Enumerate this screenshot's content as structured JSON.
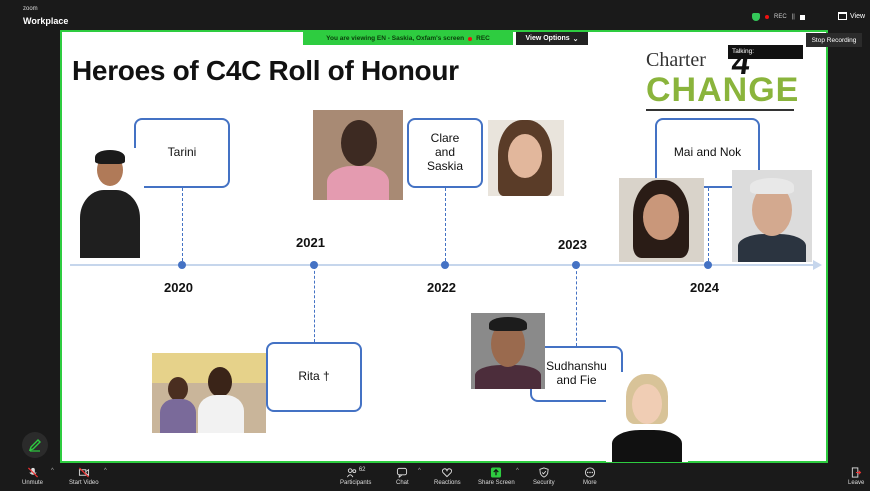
{
  "app": {
    "brand_small": "zoom",
    "brand": "Workplace",
    "rec_label": "REC",
    "view_label": "View"
  },
  "share": {
    "banner": "You are viewing  EN - Saskia, Oxfam's screen",
    "rec_label": "REC",
    "view_options": "View Options",
    "talking": "Talking:",
    "stop_recording": "Stop Recording"
  },
  "slide": {
    "title": "Heroes of C4C Roll of Honour",
    "logo_top": "Charter",
    "logo_num": "4",
    "logo_bottom": "CHANGE",
    "years": [
      "2020",
      "2021",
      "2022",
      "2023",
      "2024"
    ],
    "honourees": [
      "Tarini",
      "Rita †",
      "Clare\nand\nSaskia",
      "Sudhanshu\nand Fie",
      "Mai and Nok"
    ]
  },
  "toolbar": {
    "unmute": "Unmute",
    "start_video": "Start Video",
    "participants": "Participants",
    "participants_count": "62",
    "chat": "Chat",
    "reactions": "Reactions",
    "share_screen": "Share Screen",
    "security": "Security",
    "more": "More",
    "leave": "Leave"
  },
  "colors": {
    "accent_green": "#2ecc40",
    "timeline_blue": "#4472c4",
    "brand_green": "#8ab43c"
  }
}
